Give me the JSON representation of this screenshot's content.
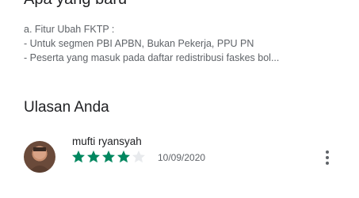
{
  "whats_new": {
    "title": "Apa yang baru",
    "notes": [
      "a. Fitur Ubah FKTP :",
      "- Untuk segmen PBI APBN, Bukan Pekerja, PPU PN",
      "- Peserta yang masuk pada daftar redistribusi faskes bol..."
    ]
  },
  "my_review": {
    "heading": "Ulasan Anda",
    "reviewer_name": "mufti ryansyah",
    "rating": 4,
    "max_rating": 5,
    "date": "10/09/2020",
    "star_color": "#01875f",
    "empty_star_color": "#e8eaed",
    "icons": {
      "more": "more-vert-icon",
      "chevron": "chevron-right-icon"
    }
  }
}
